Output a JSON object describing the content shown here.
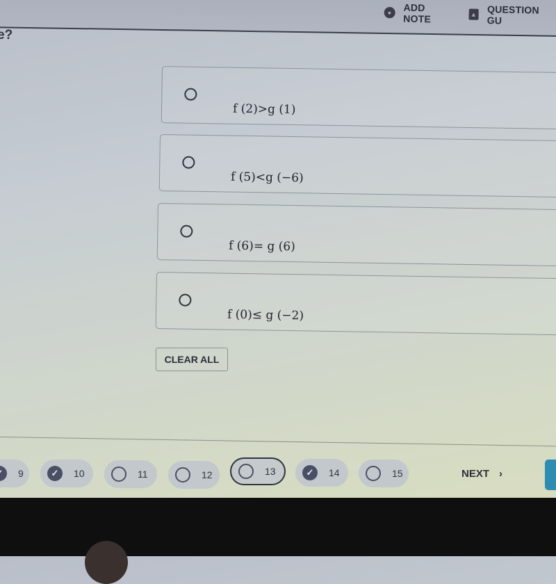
{
  "header": {
    "actions": [
      {
        "icon": "note-icon",
        "label": "ADD NOTE"
      },
      {
        "icon": "guide-icon",
        "label": "QUESTION GU"
      }
    ]
  },
  "question": {
    "text_fragment": "e?"
  },
  "options": [
    {
      "expression": "f (2)>g (1)",
      "selected": false
    },
    {
      "expression": "f (5)<g (−6)",
      "selected": false
    },
    {
      "expression": "f (6)= g (6)",
      "selected": false
    },
    {
      "expression": "f (0)≤ g (−2)",
      "selected": false
    }
  ],
  "clear_all_label": "CLEAR ALL",
  "navigation": {
    "questions": [
      {
        "number": "9",
        "status": "answered"
      },
      {
        "number": "10",
        "status": "answered"
      },
      {
        "number": "11",
        "status": "unanswered"
      },
      {
        "number": "12",
        "status": "unanswered"
      },
      {
        "number": "13",
        "status": "unanswered",
        "current": true
      },
      {
        "number": "14",
        "status": "answered"
      },
      {
        "number": "15",
        "status": "unanswered"
      }
    ],
    "next_label": "NEXT",
    "next_icon": "›"
  },
  "colors": {
    "accent": "#2e8bb1",
    "answered": "#4b4f66"
  }
}
